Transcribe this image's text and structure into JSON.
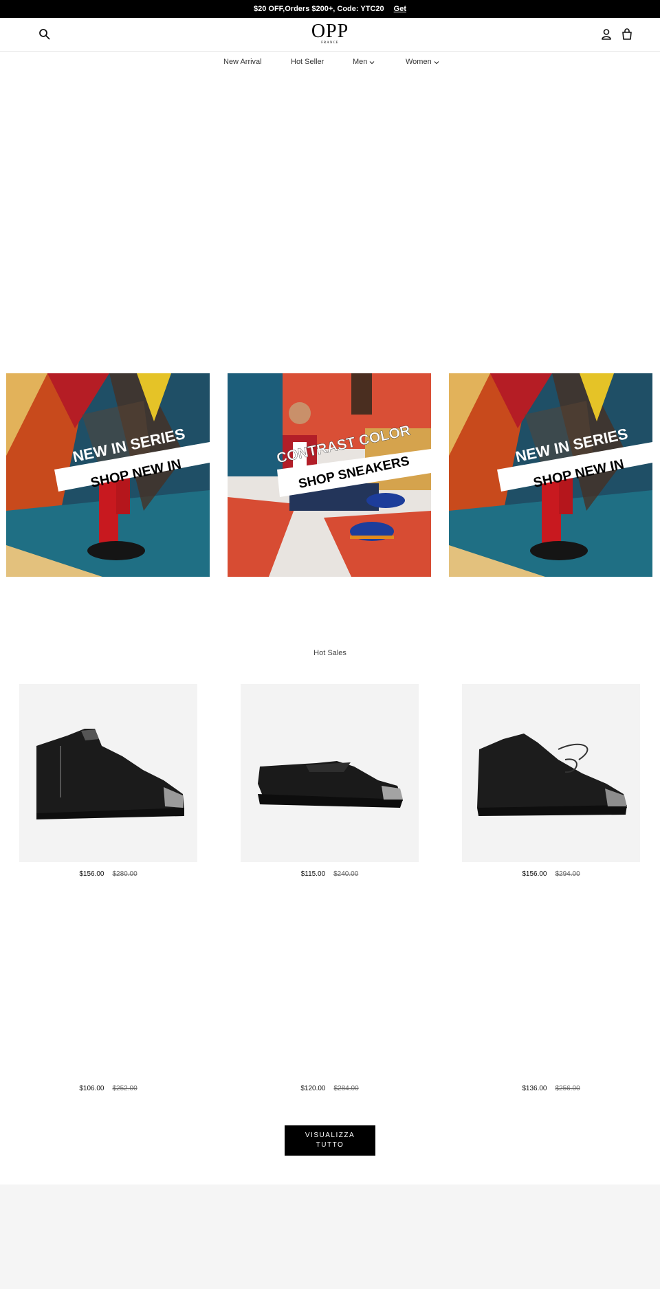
{
  "announcement": {
    "text": "$20 OFF,Orders $200+, Code: YTC20",
    "link": "Get"
  },
  "header": {
    "logo": "OPP",
    "logo_sub": "FRANCE",
    "icons": [
      "search-icon",
      "account-icon",
      "cart-icon"
    ]
  },
  "nav": {
    "items": [
      {
        "label": "New Arrival"
      },
      {
        "label": "Hot Seller"
      },
      {
        "label": "Men"
      },
      {
        "label": "Women"
      }
    ]
  },
  "banners": [
    {
      "line1": "NEW IN SERIES",
      "line2": "SHOP NEW IN"
    },
    {
      "line1": "CONTRAST COLOR",
      "line2": "SHOP SNEAKERS"
    },
    {
      "line1": "NEW IN SERIES",
      "line2": "SHOP NEW IN"
    }
  ],
  "hot_sales": {
    "title": "Hot Sales",
    "products": [
      {
        "price": "$156.00",
        "compare": "$280.00"
      },
      {
        "price": "$115.00",
        "compare": "$240.00"
      },
      {
        "price": "$156.00",
        "compare": "$294.00"
      },
      {
        "price": "$106.00",
        "compare": "$252.00"
      },
      {
        "price": "$120.00",
        "compare": "$284.00"
      },
      {
        "price": "$136.00",
        "compare": "$256.00"
      }
    ]
  },
  "view_all": "VISUALIZZA TUTTO",
  "colors": {
    "announcement_bg": "#000000",
    "button_bg": "#000000",
    "product_bg": "#f3f3f3"
  }
}
